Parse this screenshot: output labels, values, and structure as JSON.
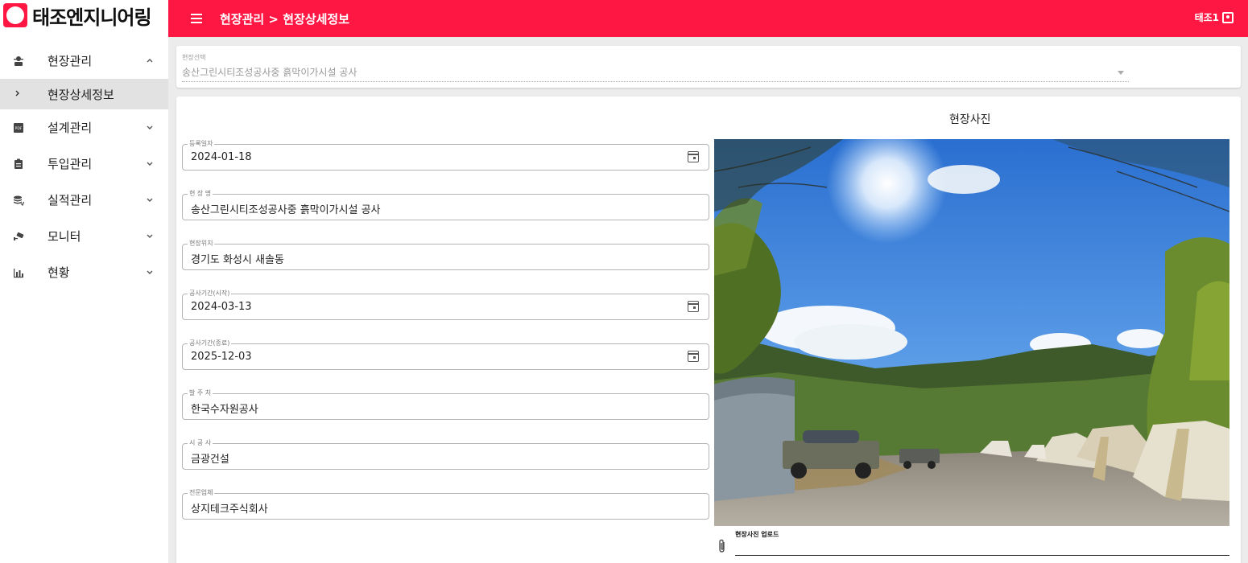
{
  "app": {
    "logo_text": "태조엔지니어링"
  },
  "topbar": {
    "breadcrumb": "현장관리 > 현장상세정보",
    "user": "태조1"
  },
  "sidebar": {
    "items": [
      {
        "label": "현장관리",
        "icon": "manager-icon",
        "expanded": true
      },
      {
        "label": "설계관리",
        "icon": "pdf-icon",
        "expanded": false
      },
      {
        "label": "투입관리",
        "icon": "clipboard-icon",
        "expanded": false
      },
      {
        "label": "실적관리",
        "icon": "coins-icon",
        "expanded": false
      },
      {
        "label": "모니터",
        "icon": "cctv-icon",
        "expanded": false
      },
      {
        "label": "현황",
        "icon": "bar-chart-icon",
        "expanded": false
      }
    ],
    "subitem": {
      "label": "현장상세정보",
      "selected": true
    }
  },
  "site_select": {
    "label": "현장선택",
    "value": "송산그린시티조성공사중 흙막이가시설 공사"
  },
  "form": {
    "reg_date": {
      "label": "등록일자",
      "value": "2024-01-18"
    },
    "site_name": {
      "label": "현 장 명",
      "value": "송산그린시티조성공사중  흙막이가시설 공사"
    },
    "location": {
      "label": "현장위치",
      "value": "경기도 화성시 새솔동"
    },
    "start_date": {
      "label": "공사기간(시작)",
      "value": "2024-03-13"
    },
    "end_date": {
      "label": "공사기간(종료)",
      "value": "2025-12-03"
    },
    "client": {
      "label": "발 주 처",
      "value": "한국수자원공사"
    },
    "contractor": {
      "label": "시 공 사",
      "value": "금광건설"
    },
    "specialist": {
      "label": "전문업체",
      "value": "상지테크주식회사"
    }
  },
  "photo": {
    "title": "현장사진",
    "upload_label": "현장사진 업로드"
  },
  "colors": {
    "accent": "#ff1744",
    "selected_bg": "#e2e2e2",
    "page_bg": "#ececec"
  }
}
